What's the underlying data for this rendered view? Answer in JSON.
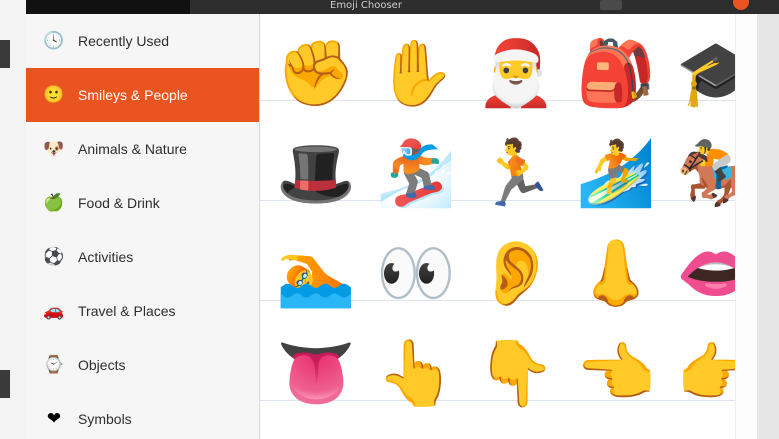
{
  "window": {
    "title": "Emoji Chooser",
    "accent_color": "#e95420"
  },
  "sidebar": {
    "items": [
      {
        "label": "Recently Used",
        "icon": "🕓",
        "icon_name": "clock-icon"
      },
      {
        "label": "Smileys & People",
        "icon": "🙂",
        "icon_name": "smiley-icon",
        "selected": true
      },
      {
        "label": "Animals & Nature",
        "icon": "🐶",
        "icon_name": "dog-icon"
      },
      {
        "label": "Food & Drink",
        "icon": "🍏",
        "icon_name": "apple-icon"
      },
      {
        "label": "Activities",
        "icon": "⚽",
        "icon_name": "soccer-ball-icon"
      },
      {
        "label": "Travel & Places",
        "icon": "🚗",
        "icon_name": "car-icon"
      },
      {
        "label": "Objects",
        "icon": "⌚",
        "icon_name": "watch-icon"
      },
      {
        "label": "Symbols",
        "icon": "❤",
        "icon_name": "heart-icon"
      }
    ]
  },
  "emojis": [
    {
      "char": "✊",
      "name": "raised-fist"
    },
    {
      "char": "✋",
      "name": "raised-hand"
    },
    {
      "char": "🎅",
      "name": "santa-claus"
    },
    {
      "char": "🎒",
      "name": "backpack"
    },
    {
      "char": "🎓",
      "name": "graduation-cap"
    },
    {
      "char": "🎩",
      "name": "top-hat"
    },
    {
      "char": "🏂",
      "name": "snowboarder"
    },
    {
      "char": "🏃",
      "name": "person-running"
    },
    {
      "char": "🏄",
      "name": "person-surfing"
    },
    {
      "char": "🏇",
      "name": "horse-racing"
    },
    {
      "char": "🏊",
      "name": "person-swimming"
    },
    {
      "char": "👀",
      "name": "eyes"
    },
    {
      "char": "👂",
      "name": "ear"
    },
    {
      "char": "👃",
      "name": "nose"
    },
    {
      "char": "👄",
      "name": "mouth"
    },
    {
      "char": "👅",
      "name": "tongue"
    },
    {
      "char": "👆",
      "name": "pointing-up"
    },
    {
      "char": "👇",
      "name": "pointing-down"
    },
    {
      "char": "👈",
      "name": "pointing-left"
    },
    {
      "char": "👉",
      "name": "pointing-right"
    }
  ]
}
